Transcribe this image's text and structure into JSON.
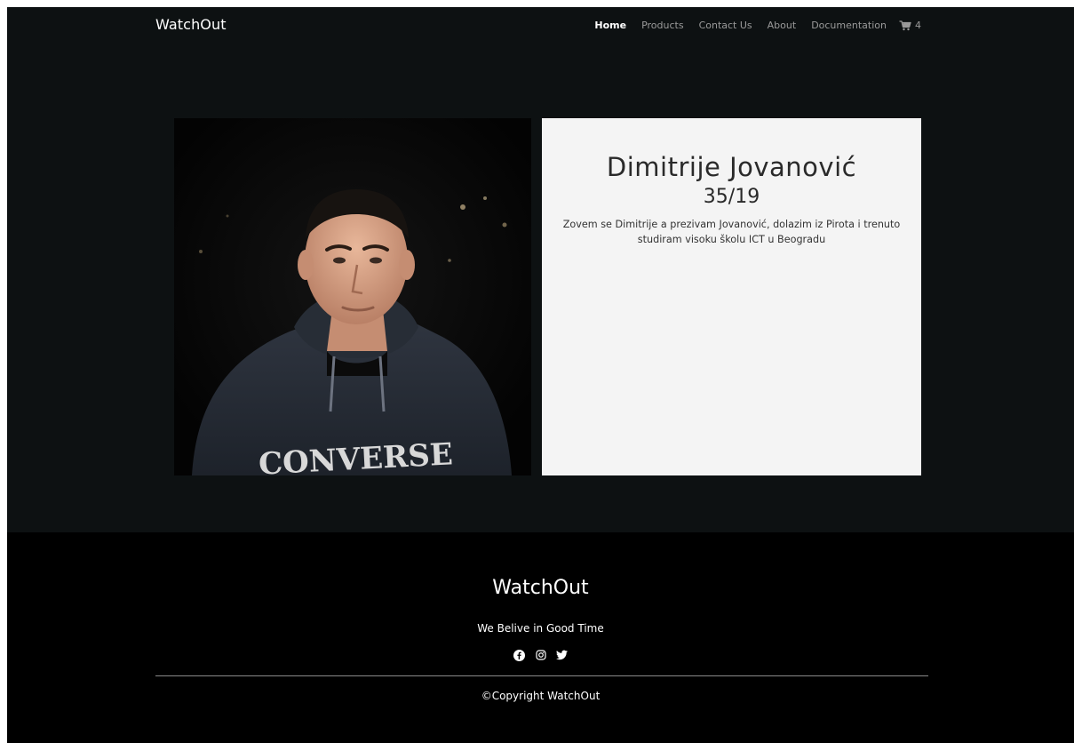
{
  "navbar": {
    "brand": "WatchOut",
    "links": [
      {
        "label": "Home",
        "active": true
      },
      {
        "label": "Products"
      },
      {
        "label": "Contact Us"
      },
      {
        "label": "About"
      },
      {
        "label": "Documentation"
      }
    ],
    "cart_count": "4",
    "cart_icon": "cart-icon"
  },
  "profile": {
    "name": "Dimitrije Jovanović",
    "index": "35/19",
    "bio": "Zovem se Dimitrije a prezivam Jovanović, dolazim iz Pirota i trenuto studiram visoku školu ICT u Beogradu"
  },
  "footer": {
    "brand": "WatchOut",
    "tagline": "We Belive in Good Time",
    "social_icons": [
      "facebook-icon",
      "instagram-icon",
      "twitter-icon"
    ],
    "copyright": "©Copyright WatchOut"
  },
  "colors": {
    "page_bg": "#0d1112",
    "footer_bg": "#000000",
    "card_bg": "#f4f4f4",
    "nav_inactive": "#9a9a9a"
  }
}
